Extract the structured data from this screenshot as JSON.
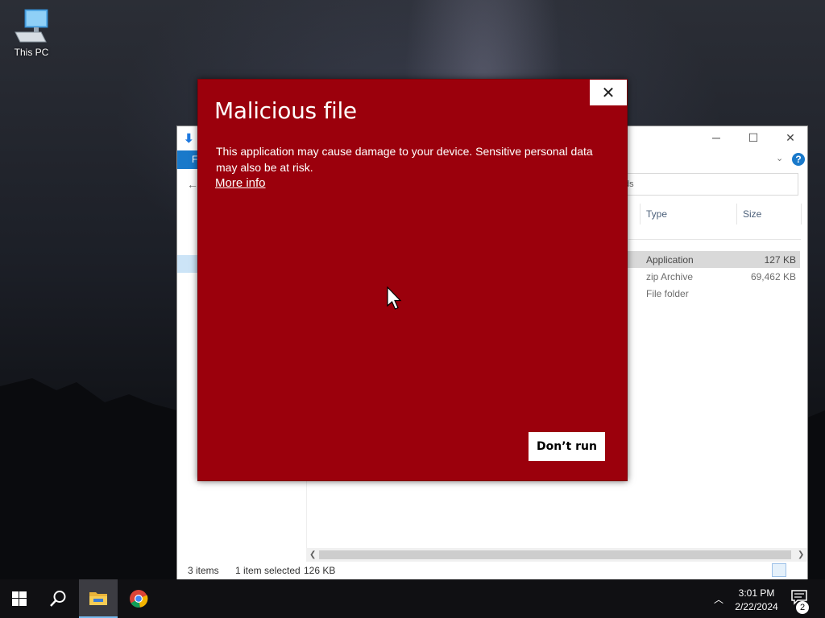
{
  "desktop": {
    "icons": [
      {
        "label": "This PC",
        "icon": "this-pc-icon"
      }
    ]
  },
  "explorer": {
    "search_placeholder": "ds",
    "columns": {
      "type": "Type",
      "size": "Size"
    },
    "rows": [
      {
        "type": "Application",
        "size": "127 KB",
        "selected": true
      },
      {
        "type": "zip Archive",
        "size": "69,462 KB",
        "selected": false
      },
      {
        "type": "File folder",
        "size": "",
        "selected": false
      }
    ],
    "file_tab_label": "F",
    "help_label": "?",
    "status": {
      "items": "3 items",
      "selected": "1 item selected",
      "selected_size": "126 KB"
    }
  },
  "dialog": {
    "title": "Malicious file",
    "message": "This application may cause damage to your device. Sensitive personal data may also be at risk.",
    "more_info_label": "More info",
    "dont_run_label": "Don’t run",
    "close_label": "✕",
    "background_color": "#9b000c"
  },
  "taskbar": {
    "apps": [
      {
        "name": "start",
        "icon": "windows-logo-icon"
      },
      {
        "name": "search",
        "icon": "search-icon"
      },
      {
        "name": "file-explorer",
        "icon": "folder-icon",
        "active": true
      },
      {
        "name": "chrome",
        "icon": "chrome-icon"
      }
    ],
    "time": "3:01 PM",
    "date": "2/22/2024",
    "notification_count": "2"
  }
}
